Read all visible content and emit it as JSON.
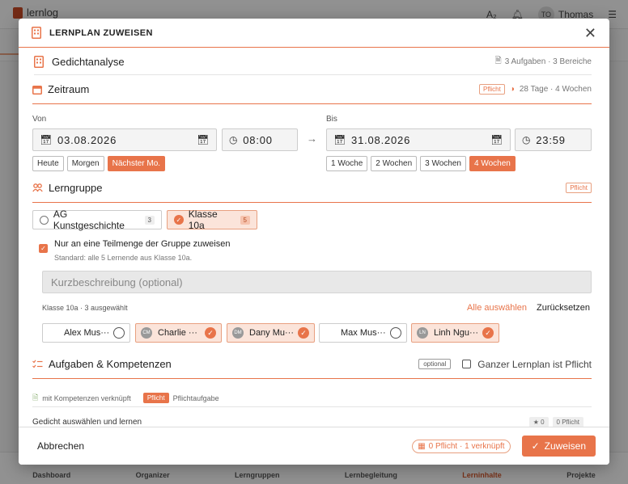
{
  "background": {
    "logo": "lernlog",
    "user_initials": "TO",
    "user_name": "Thomas",
    "nav": [
      "Dashboard",
      "Organizer",
      "Lerngruppen",
      "Lernbegleitung",
      "Lerninhalte",
      "Projekte"
    ]
  },
  "modal": {
    "title": "LERNPLAN ZUWEISEN",
    "plan_name": "Gedichtanalyse",
    "plan_meta": "3 Aufgaben · 3 Bereiche"
  },
  "zeitraum": {
    "title": "Zeitraum",
    "badge": "Pflicht",
    "duration": "28 Tage · 4 Wochen",
    "von_label": "Von",
    "bis_label": "Bis",
    "von_date": "03.08.2026",
    "von_time": "08:00",
    "bis_date": "31.08.2026",
    "bis_time": "23:59",
    "von_quick": [
      "Heute",
      "Morgen",
      "Nächster Mo."
    ],
    "bis_quick": [
      "1 Woche",
      "2 Wochen",
      "3 Wochen",
      "4 Wochen"
    ]
  },
  "lerngruppe": {
    "title": "Lerngruppe",
    "badge": "Pflicht",
    "groups": [
      {
        "name": "AG Kunstgeschichte",
        "count": "3"
      },
      {
        "name": "Klasse 10a",
        "count": "5"
      }
    ],
    "subset_label": "Nur an eine Teilmenge der Gruppe zuweisen",
    "subset_hint": "Standard: alle 5 Lernende aus Klasse 10a.",
    "desc_placeholder": "Kurzbeschreibung (optional)",
    "selection_info": "Klasse 10a · 3 ausgewählt",
    "select_all": "Alle auswählen",
    "reset": "Zurücksetzen",
    "members": [
      {
        "initials": "",
        "name": "Alex Mus···"
      },
      {
        "initials": "CM",
        "name": "Charlie ···"
      },
      {
        "initials": "DM",
        "name": "Dany Mu···"
      },
      {
        "initials": "",
        "name": "Max Mus···"
      },
      {
        "initials": "LN",
        "name": "Linh Ngu···"
      }
    ]
  },
  "aufgaben": {
    "title": "Aufgaben & Kompetenzen",
    "badge": "optional",
    "whole_plan_label": "Ganzer Lernplan ist Pflicht",
    "legend_linked": "mit Kompetenzen verknüpft",
    "legend_pflicht_badge": "Pflicht",
    "legend_pflicht_text": "Pflichtaufgabe",
    "first_task": "Gedicht auswählen und lernen",
    "first_task_stars": "★ 0",
    "first_task_pflicht": "0 Pflicht"
  },
  "footer": {
    "cancel": "Abbrechen",
    "summary": "0 Pflicht · 1 verknüpft",
    "submit": "Zuweisen"
  },
  "colors": {
    "accent": "#e8744a",
    "accent_light": "#fbe4da"
  }
}
